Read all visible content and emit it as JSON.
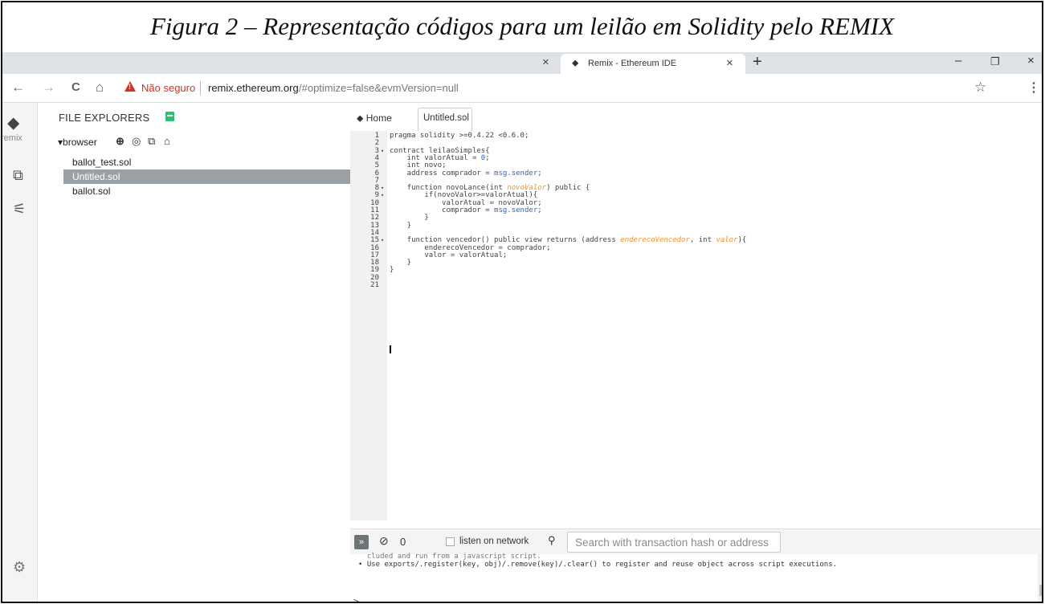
{
  "caption": "Figura 2 – Representação códigos para um leilão em Solidity pelo REMIX",
  "browser": {
    "tab_title": "Remix - Ethereum IDE",
    "close_glyph": "×",
    "new_tab_glyph": "+",
    "window_controls": [
      "–",
      "❐",
      "×"
    ],
    "nav_icons": [
      "←",
      "→",
      "C",
      "⌂"
    ],
    "security_label": "Não seguro",
    "url_host": "remix.ethereum.org",
    "url_rest": "/#optimize=false&evmVersion=null",
    "bookmark_icon": "☆",
    "menu_icon": "⋮"
  },
  "icon_panel": {
    "logo_text": "remix"
  },
  "explorer": {
    "title": "FILE EXPLORERS",
    "workspace": "▾browser",
    "files": [
      "ballot_test.sol",
      "Untitled.sol",
      "ballot.sol"
    ],
    "active_file_index": 1
  },
  "editor": {
    "home_tab": "Home",
    "active_tab": "Untitled.sol",
    "tab_close": "×",
    "line_numbers": [
      "1",
      "2",
      "3",
      "4",
      "5",
      "6",
      "7",
      "8",
      "9",
      "10",
      "11",
      "12",
      "13",
      "14",
      "15",
      "16",
      "17",
      "18",
      "19",
      "20",
      "21"
    ],
    "fold_markers": {
      "3": "▾",
      "8": "▾",
      "9": "▾",
      "15": "▾"
    }
  },
  "code": [
    [
      {
        "t": "pragma solidity >=0.4.22 <0.6.0;",
        "c": "kw"
      }
    ],
    [],
    [
      {
        "t": "contract leilaoSimples{",
        "c": "kw"
      }
    ],
    [
      {
        "t": "    int valorAtual = ",
        "c": "kw"
      },
      {
        "t": "0",
        "c": "str"
      },
      {
        "t": ";",
        "c": "kw"
      }
    ],
    [
      {
        "t": "    int novo;",
        "c": "kw"
      }
    ],
    [
      {
        "t": "    address comprador = ",
        "c": "kw"
      },
      {
        "t": "msg.sender",
        "c": "str"
      },
      {
        "t": ";",
        "c": "kw"
      }
    ],
    [],
    [
      {
        "t": "    function novoLance(int ",
        "c": "kw"
      },
      {
        "t": "novoValor",
        "c": "param"
      },
      {
        "t": ") public {",
        "c": "kw"
      }
    ],
    [
      {
        "t": "        if(novoValor>=valorAtual){",
        "c": "kw"
      }
    ],
    [
      {
        "t": "            valorAtual = novoValor;",
        "c": "kw"
      }
    ],
    [
      {
        "t": "            comprador = ",
        "c": "kw"
      },
      {
        "t": "msg.sender",
        "c": "str"
      },
      {
        "t": ";",
        "c": "kw"
      }
    ],
    [
      {
        "t": "        }",
        "c": "kw"
      }
    ],
    [
      {
        "t": "    }",
        "c": "kw"
      }
    ],
    [],
    [
      {
        "t": "    function vencedor() public view returns (address ",
        "c": "kw"
      },
      {
        "t": "enderecoVencedor",
        "c": "param"
      },
      {
        "t": ", int ",
        "c": "kw"
      },
      {
        "t": "valor",
        "c": "param"
      },
      {
        "t": "){",
        "c": "kw"
      }
    ],
    [
      {
        "t": "        enderecoVencedor = comprador;",
        "c": "kw"
      }
    ],
    [
      {
        "t": "        valor = valorAtual;",
        "c": "kw"
      }
    ],
    [
      {
        "t": "    }",
        "c": "kw"
      }
    ],
    [
      {
        "t": "}",
        "c": "kw"
      }
    ],
    [],
    []
  ],
  "terminal": {
    "toggle_icon": "»",
    "clear_icon": "⊘",
    "pending_count": "0",
    "listen_label": "listen on network",
    "search_icon": "🔍",
    "search_placeholder": "Search with transaction hash or address",
    "output_partial": "  cluded and run from a javascript script.",
    "output_line": "• Use exports/.register(key, obj)/.remove(key)/.clear() to register and reuse object across script executions.",
    "prompt": ">"
  }
}
